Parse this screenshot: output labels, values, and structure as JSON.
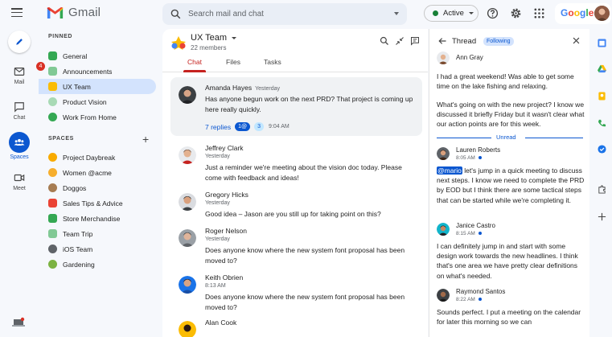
{
  "app": {
    "name": "Gmail"
  },
  "search": {
    "placeholder": "Search mail and chat"
  },
  "status": {
    "label": "Active",
    "color": "#188038"
  },
  "account": {
    "brand": "Google"
  },
  "rail": {
    "mail": {
      "label": "Mail",
      "badge": "4"
    },
    "chat": {
      "label": "Chat"
    },
    "spaces": {
      "label": "Spaces"
    },
    "meet": {
      "label": "Meet"
    }
  },
  "nav": {
    "pinned_heading": "PINNED",
    "pinned": [
      {
        "label": "General",
        "color": "#34a853"
      },
      {
        "label": "Announcements",
        "color": "#81c995"
      },
      {
        "label": "UX Team",
        "color": "#fbbc04"
      },
      {
        "label": "Product Vision",
        "color": "#a8dab5"
      },
      {
        "label": "Work From Home",
        "color": "#34a853"
      }
    ],
    "spaces_heading": "SPACES",
    "spaces": [
      {
        "label": "Project Daybreak",
        "color": "#f9ab00"
      },
      {
        "label": "Women @acme",
        "color": "#f6ae2d"
      },
      {
        "label": "Doggos",
        "color": "#a67c52"
      },
      {
        "label": "Sales Tips & Advice",
        "color": "#ea4335"
      },
      {
        "label": "Store Merchandise",
        "color": "#34a853"
      },
      {
        "label": "Team Trip",
        "color": "#81c995"
      },
      {
        "label": "iOS Team",
        "color": "#5f6368"
      },
      {
        "label": "Gardening",
        "color": "#7cb342"
      }
    ]
  },
  "room": {
    "name": "UX Team",
    "members": "22 members",
    "tabs": [
      "Chat",
      "Files",
      "Tasks"
    ]
  },
  "messages": [
    {
      "name": "Amanda Hayes",
      "time": "Yesterday",
      "text": "Has anyone begun work on the next PRD? That project is coming up here really quickly.",
      "replies": "7 replies",
      "mentions": "1@",
      "count": "3",
      "reply_time": "9:04 AM"
    },
    {
      "name": "Jeffrey Clark",
      "time": "Yesterday",
      "text": "Just a reminder we're meeting about the vision doc today. Please come with feedback and ideas!"
    },
    {
      "name": "Gregory Hicks",
      "time": "Yesterday",
      "text": "Good idea – Jason are you still up for taking point on this?"
    },
    {
      "name": "Roger Nelson",
      "time": "Yesterday",
      "text": "Does anyone know where the new system font proposal has been moved to?"
    },
    {
      "name": "Keith Obrien",
      "time": "8:13 AM",
      "text": "Does anyone know where the new system font proposal has been moved to?"
    },
    {
      "name": "Alan Cook",
      "time": ""
    }
  ],
  "thread": {
    "title": "Thread",
    "following": "Following",
    "unread_label": "Unread",
    "messages": [
      {
        "name": "Ann Gray",
        "text": "I had a great weekend! Was able to get some time on the lake fishing and relaxing."
      },
      {
        "name": "",
        "text": "What's going on with the new project? I know we discussed it briefly Friday but it wasn't clear what our action points are for this week."
      },
      {
        "name": "Lauren Roberts",
        "time": "8:05 AM",
        "mention": "@mario",
        "text": " let's jump in a quick meeting to discuss next steps. I know we need to complete the PRD by EOD but I think there are some tactical steps that can be started while we're completing it."
      },
      {
        "name": "Janice Castro",
        "time": "8:15 AM",
        "text": "I can definitely jump in and start with some design work towards the new headlines. I think that's one area we have pretty clear definitions on what's needed."
      },
      {
        "name": "Raymond Santos",
        "time": "8:22 AM",
        "text": "Sounds perfect. I put a meeting on the calendar for later this morning so we can"
      }
    ]
  }
}
